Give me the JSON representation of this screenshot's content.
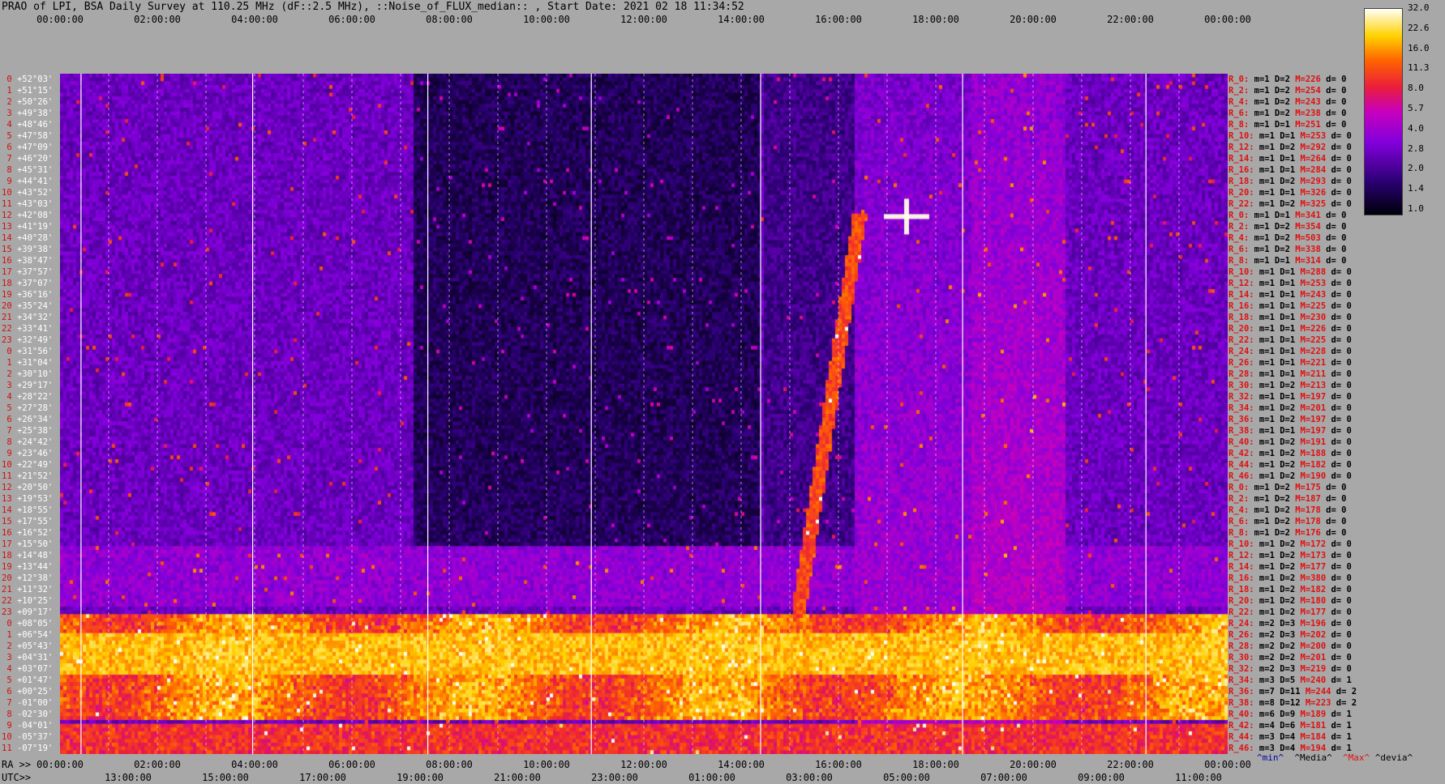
{
  "title": "PRAO of LPI, BSA Daily Survey at 110.25 MHz (dF::2.5 MHz), ::Noise_of_FLUX_median:: , Start Date: 2021 02 18 11:34:52",
  "top_ticks": [
    "00:00:00",
    "02:00:00",
    "04:00:00",
    "06:00:00",
    "08:00:00",
    "10:00:00",
    "12:00:00",
    "14:00:00",
    "16:00:00",
    "18:00:00",
    "20:00:00",
    "22:00:00",
    "00:00:00"
  ],
  "ra_prefix": "RA >>",
  "ra_ticks": [
    "00:00:00",
    "02:00:00",
    "04:00:00",
    "06:00:00",
    "08:00:00",
    "10:00:00",
    "12:00:00",
    "14:00:00",
    "16:00:00",
    "18:00:00",
    "20:00:00",
    "22:00:00",
    "00:00:00"
  ],
  "utc_prefix": "UTC>>",
  "utc_ticks": [
    "13:00:00",
    "15:00:00",
    "17:00:00",
    "19:00:00",
    "21:00:00",
    "23:00:00",
    "01:00:00",
    "03:00:00",
    "05:00:00",
    "07:00:00",
    "09:00:00",
    "11:00:00"
  ],
  "colorbar_labels": [
    "32.0",
    "22.6",
    "16.0",
    "11.3",
    "8.0",
    "5.7",
    "4.0",
    "2.8",
    "2.0",
    "1.4",
    "1.0"
  ],
  "footer": {
    "min": "^min^",
    "media": "^Media^",
    "max": "^Max^",
    "devia": "^devia^"
  },
  "chart_data": {
    "type": "heatmap",
    "title": "PRAO of LPI, BSA Daily Survey at 110.25 MHz (dF::2.5 MHz), ::Noise_of_FLUX_median:: , Start Date: 2021 02 18 11:34:52",
    "x_axis": "RA 00:00:00 – 24:00:00",
    "colorbar": {
      "min": 1.0,
      "max": 32.0,
      "scale": "log"
    },
    "declinations": [
      "+52°03'",
      "+51°15'",
      "+50°26'",
      "+49°38'",
      "+48°46'",
      "+47°58'",
      "+47°09'",
      "+46°20'",
      "+45°31'",
      "+44°41'",
      "+43°52'",
      "+43°03'",
      "+42°08'",
      "+41°19'",
      "+40°28'",
      "+39°38'",
      "+38°47'",
      "+37°57'",
      "+37°07'",
      "+36°16'",
      "+35°24'",
      "+34°32'",
      "+33°41'",
      "+32°49'",
      "+31°56'",
      "+31°04'",
      "+30°10'",
      "+29°17'",
      "+28°22'",
      "+27°28'",
      "+26°34'",
      "+25°38'",
      "+24°42'",
      "+23°46'",
      "+22°49'",
      "+21°52'",
      "+20°50'",
      "+19°53'",
      "+18°55'",
      "+17°55'",
      "+16°52'",
      "+15°50'",
      "+14°48'",
      "+13°44'",
      "+12°38'",
      "+11°32'",
      "+10°25'",
      "+09°17'",
      "+08°05'",
      "+06°54'",
      "+05°43'",
      "+04°31'",
      "+03°07'",
      "+01°47'",
      "+00°25'",
      "-01°00'",
      "-02°30'",
      "-04°01'",
      "-05°37'",
      "-07°19'"
    ],
    "row_stats": [
      [
        "R_0:",
        "1",
        "2",
        "226",
        "0"
      ],
      [
        "R_2:",
        "1",
        "2",
        "254",
        "0"
      ],
      [
        "R_4:",
        "1",
        "2",
        "243",
        "0"
      ],
      [
        "R_6:",
        "1",
        "2",
        "238",
        "0"
      ],
      [
        "R_8:",
        "1",
        "1",
        "251",
        "0"
      ],
      [
        "R_10:",
        "1",
        "1",
        "253",
        "0"
      ],
      [
        "R_12:",
        "1",
        "2",
        "292",
        "0"
      ],
      [
        "R_14:",
        "1",
        "1",
        "264",
        "0"
      ],
      [
        "R_16:",
        "1",
        "1",
        "284",
        "0"
      ],
      [
        "R_18:",
        "1",
        "2",
        "293",
        "0"
      ],
      [
        "R_20:",
        "1",
        "1",
        "326",
        "0"
      ],
      [
        "R_22:",
        "1",
        "2",
        "325",
        "0"
      ],
      [
        "R_0:",
        "1",
        "1",
        "341",
        "0"
      ],
      [
        "R_2:",
        "1",
        "2",
        "354",
        "0"
      ],
      [
        "R_4:",
        "1",
        "2",
        "503",
        "0"
      ],
      [
        "R_6:",
        "1",
        "2",
        "338",
        "0"
      ],
      [
        "R_8:",
        "1",
        "1",
        "314",
        "0"
      ],
      [
        "R_10:",
        "1",
        "1",
        "288",
        "0"
      ],
      [
        "R_12:",
        "1",
        "1",
        "253",
        "0"
      ],
      [
        "R_14:",
        "1",
        "1",
        "243",
        "0"
      ],
      [
        "R_16:",
        "1",
        "1",
        "225",
        "0"
      ],
      [
        "R_18:",
        "1",
        "1",
        "230",
        "0"
      ],
      [
        "R_20:",
        "1",
        "1",
        "226",
        "0"
      ],
      [
        "R_22:",
        "1",
        "1",
        "225",
        "0"
      ],
      [
        "R_24:",
        "1",
        "1",
        "228",
        "0"
      ],
      [
        "R_26:",
        "1",
        "1",
        "221",
        "0"
      ],
      [
        "R_28:",
        "1",
        "1",
        "211",
        "0"
      ],
      [
        "R_30:",
        "1",
        "2",
        "213",
        "0"
      ],
      [
        "R_32:",
        "1",
        "1",
        "197",
        "0"
      ],
      [
        "R_34:",
        "1",
        "2",
        "201",
        "0"
      ],
      [
        "R_36:",
        "1",
        "2",
        "197",
        "0"
      ],
      [
        "R_38:",
        "1",
        "1",
        "197",
        "0"
      ],
      [
        "R_40:",
        "1",
        "2",
        "191",
        "0"
      ],
      [
        "R_42:",
        "1",
        "2",
        "188",
        "0"
      ],
      [
        "R_44:",
        "1",
        "2",
        "182",
        "0"
      ],
      [
        "R_46:",
        "1",
        "2",
        "190",
        "0"
      ],
      [
        "R_0:",
        "1",
        "2",
        "175",
        "0"
      ],
      [
        "R_2:",
        "1",
        "2",
        "187",
        "0"
      ],
      [
        "R_4:",
        "1",
        "2",
        "178",
        "0"
      ],
      [
        "R_6:",
        "1",
        "2",
        "178",
        "0"
      ],
      [
        "R_8:",
        "1",
        "2",
        "176",
        "0"
      ],
      [
        "R_10:",
        "1",
        "2",
        "172",
        "0"
      ],
      [
        "R_12:",
        "1",
        "2",
        "173",
        "0"
      ],
      [
        "R_14:",
        "1",
        "2",
        "177",
        "0"
      ],
      [
        "R_16:",
        "1",
        "2",
        "380",
        "0"
      ],
      [
        "R_18:",
        "1",
        "2",
        "182",
        "0"
      ],
      [
        "R_20:",
        "1",
        "2",
        "180",
        "0"
      ],
      [
        "R_22:",
        "1",
        "2",
        "177",
        "0"
      ],
      [
        "R_24:",
        "2",
        "3",
        "196",
        "0"
      ],
      [
        "R_26:",
        "2",
        "3",
        "202",
        "0"
      ],
      [
        "R_28:",
        "2",
        "2",
        "200",
        "0"
      ],
      [
        "R_30:",
        "2",
        "2",
        "201",
        "0"
      ],
      [
        "R_32:",
        "2",
        "3",
        "219",
        "0"
      ],
      [
        "R_34:",
        "3",
        "5",
        "240",
        "1"
      ],
      [
        "R_36:",
        "7",
        "11",
        "244",
        "2"
      ],
      [
        "R_38:",
        "8",
        "12",
        "223",
        "2"
      ],
      [
        "R_40:",
        "6",
        "9",
        "189",
        "1"
      ],
      [
        "R_42:",
        "4",
        "6",
        "181",
        "1"
      ],
      [
        "R_44:",
        "3",
        "4",
        "184",
        "1"
      ],
      [
        "R_46:",
        "3",
        "4",
        "194",
        "1"
      ]
    ]
  }
}
